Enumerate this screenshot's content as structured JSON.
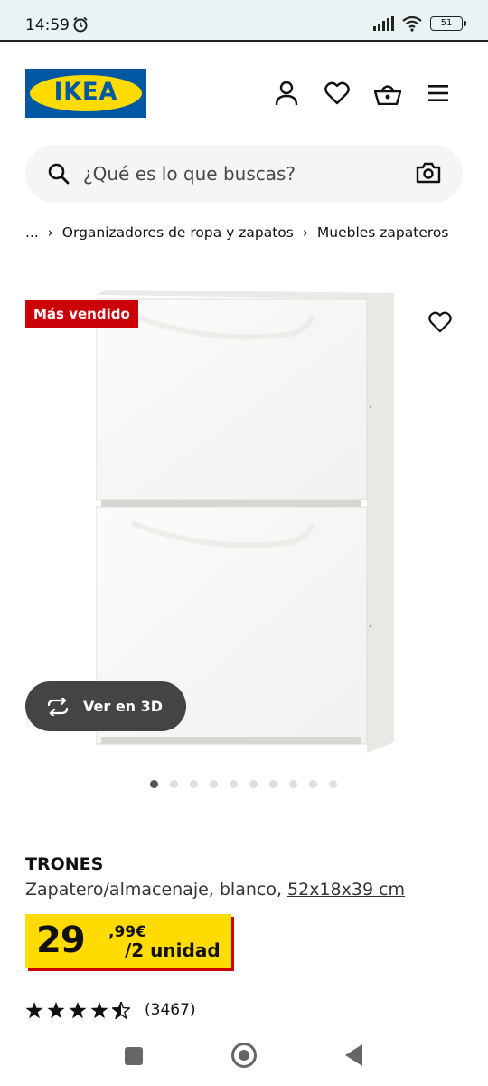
{
  "status_bar": {
    "time": "14:59",
    "battery": "51"
  },
  "header": {
    "logo_text": "IKEA",
    "icons": [
      "account-icon",
      "heart-icon",
      "basket-icon",
      "menu-icon"
    ]
  },
  "search": {
    "placeholder": "¿Qué es lo que buscas?"
  },
  "breadcrumb": {
    "items": [
      "...",
      "Organizadores de ropa y zapatos",
      "Muebles zapateros"
    ]
  },
  "gallery": {
    "badge": "Más vendido",
    "view3d_label": "Ver en 3D",
    "image_count": 10,
    "active_index": 0
  },
  "product": {
    "name": "TRONES",
    "description": "Zapatero/almacenaje, blanco, ",
    "size": "52x18x39 cm",
    "price_integer": "29",
    "price_decimal": ",99€",
    "price_unit": "/2 unidad",
    "rating_stars": 4.5,
    "review_count": "(3467)"
  },
  "colors": {
    "ikea_blue": "#0058a3",
    "ikea_yellow": "#ffdb00",
    "badge_red": "#cc0008"
  }
}
